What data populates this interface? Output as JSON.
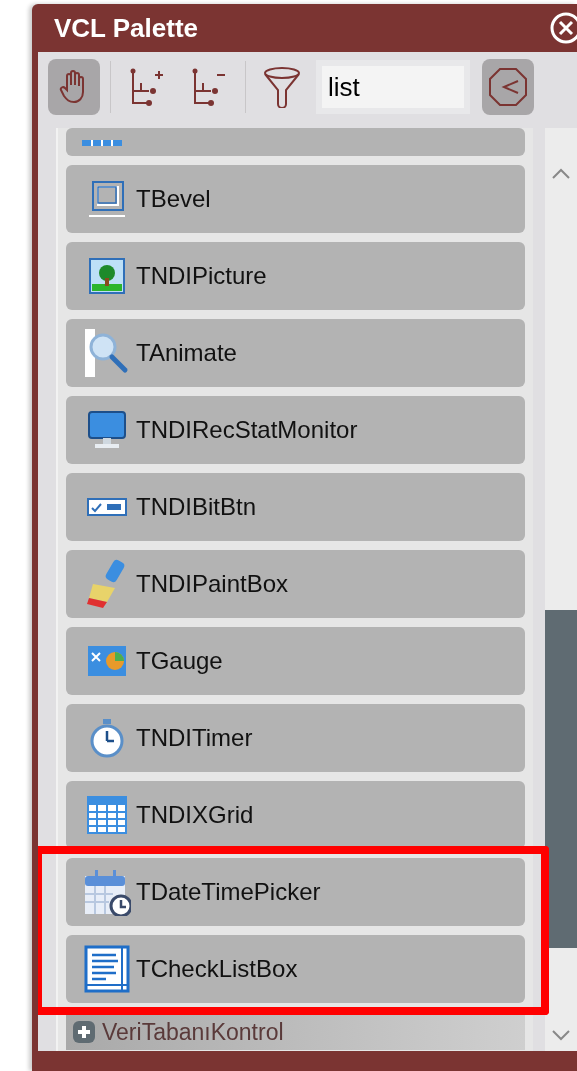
{
  "window": {
    "title": "VCL Palette"
  },
  "toolbar": {
    "search": {
      "value": "list"
    }
  },
  "items": [
    {
      "label": "TBevel",
      "kind": "bevel",
      "highlighted": false
    },
    {
      "label": "TNDIPicture",
      "kind": "picture",
      "highlighted": false
    },
    {
      "label": "TAnimate",
      "kind": "magnifier",
      "highlighted": false
    },
    {
      "label": "TNDIRecStatMonitor",
      "kind": "monitor",
      "highlighted": false
    },
    {
      "label": "TNDIBitBtn",
      "kind": "bitbtn",
      "highlighted": false
    },
    {
      "label": "TNDIPaintBox",
      "kind": "paint",
      "highlighted": false
    },
    {
      "label": "TGauge",
      "kind": "gauge",
      "highlighted": false
    },
    {
      "label": "TNDITimer",
      "kind": "timer",
      "highlighted": false
    },
    {
      "label": "TNDIXGrid",
      "kind": "grid",
      "highlighted": false
    },
    {
      "label": "TDateTimePicker",
      "kind": "calendar",
      "highlighted": true
    },
    {
      "label": "TCheckListBox",
      "kind": "listbox",
      "highlighted": true
    }
  ],
  "group": {
    "label": "VeriTabanıKontrol",
    "expanded": false
  }
}
